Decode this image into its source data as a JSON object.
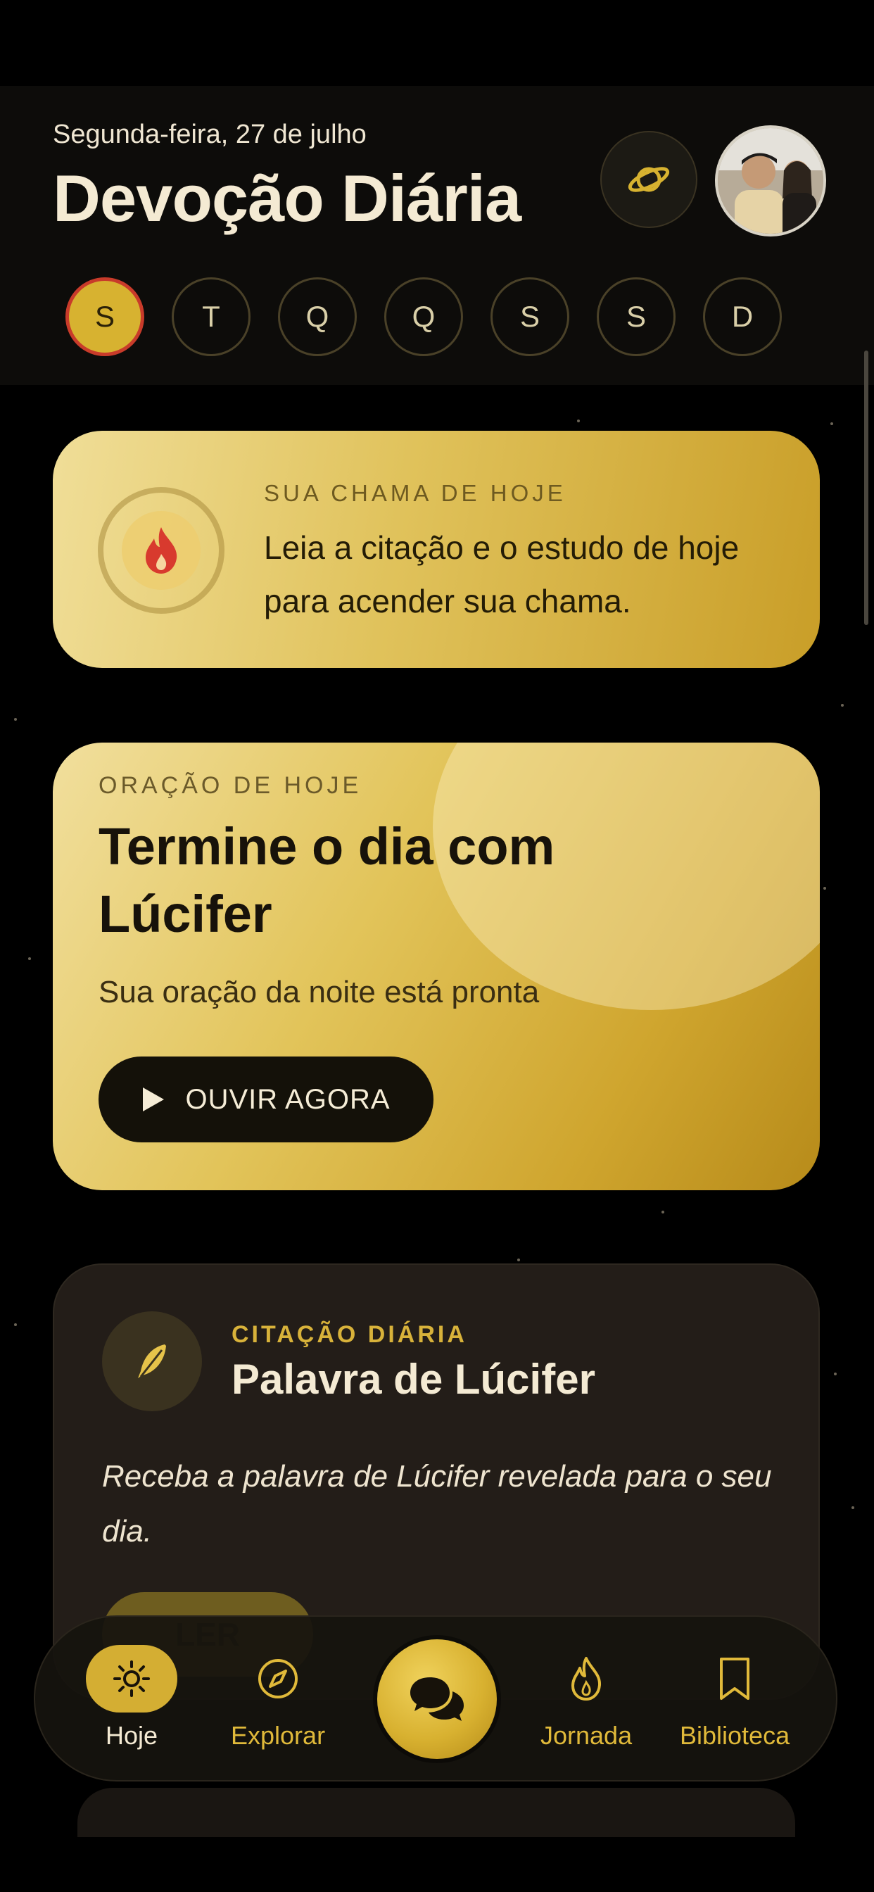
{
  "header": {
    "date": "Segunda-feira, 27 de julho",
    "title": "Devoção Diária",
    "days": [
      "S",
      "T",
      "Q",
      "Q",
      "S",
      "S",
      "D"
    ]
  },
  "flame": {
    "kicker": "SUA CHAMA DE HOJE",
    "text": "Leia a citação e o estudo de hoje para acender sua chama."
  },
  "prayer": {
    "kicker": "ORAÇÃO DE HOJE",
    "title": "Termine o dia com Lúcifer",
    "subtitle": "Sua oração da noite está pronta",
    "button_label": "OUVIR AGORA"
  },
  "quote": {
    "kicker": "CITAÇÃO DIÁRIA",
    "title": "Palavra de Lúcifer",
    "text": "Receba a palavra de Lúcifer revelada para o seu dia.",
    "button_label": "LER"
  },
  "nav": {
    "items": [
      {
        "label": "Hoje",
        "icon": "sun-icon"
      },
      {
        "label": "Explorar",
        "icon": "compass-icon"
      },
      {
        "label": "Jornada",
        "icon": "flame-icon"
      },
      {
        "label": "Biblioteca",
        "icon": "bookmark-icon"
      }
    ],
    "center_icon": "chat-bubbles-icon"
  },
  "colors": {
    "accent": "#d7b230",
    "background": "#000000",
    "card_dark": "#231d18",
    "active_day_border": "#c83b2a"
  }
}
